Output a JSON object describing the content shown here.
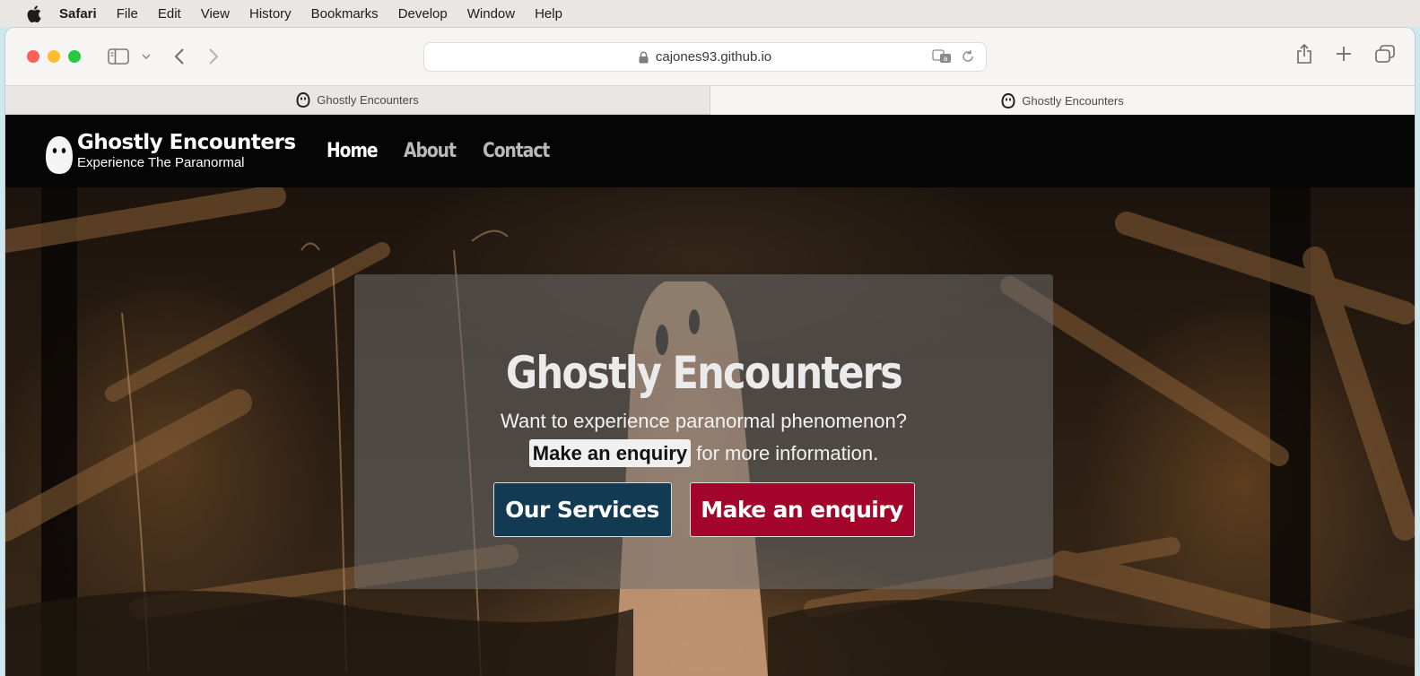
{
  "menubar": {
    "app": "Safari",
    "items": [
      "File",
      "Edit",
      "View",
      "History",
      "Bookmarks",
      "Develop",
      "Window",
      "Help"
    ]
  },
  "browser": {
    "url": "cajones93.github.io",
    "tabs": [
      {
        "title": "Ghostly Encounters",
        "active": false
      },
      {
        "title": "Ghostly Encounters",
        "active": true
      }
    ]
  },
  "site": {
    "brand": "Ghostly Encounters",
    "tagline": "Experience The Paranormal",
    "nav": [
      {
        "label": "Home",
        "current": true
      },
      {
        "label": "About",
        "current": false
      },
      {
        "label": "Contact",
        "current": false
      }
    ]
  },
  "hero": {
    "title": "Ghostly Encounters",
    "line1": "Want to experience paranormal phenomenon?",
    "line2_link": "Make an enquiry",
    "line2_rest": " for more information.",
    "button_services": "Our Services",
    "button_enquiry": "Make an enquiry"
  },
  "colors": {
    "services_button": "#123a52",
    "enquiry_button": "#a3062a",
    "header_bg": "#050505"
  }
}
